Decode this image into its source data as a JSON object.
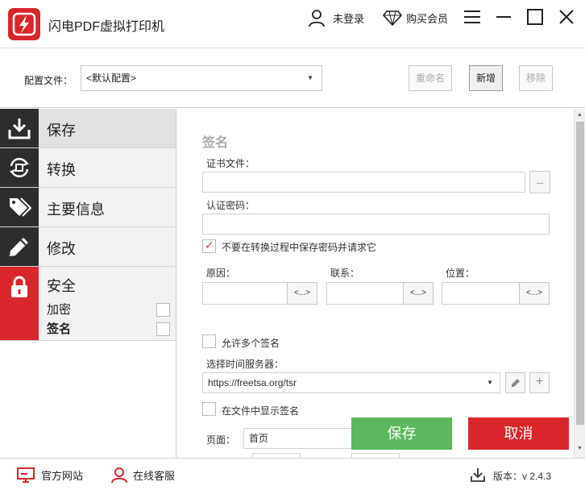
{
  "app": {
    "title": "闪电PDF虚拟打印机"
  },
  "header": {
    "login_label": "未登录",
    "vip_label": "购买会员"
  },
  "config": {
    "label": "配置文件：",
    "selected": "<默认配置>",
    "rename_label": "重命名",
    "new_label": "新增",
    "remove_label": "移除"
  },
  "sidebar": {
    "items": [
      {
        "label": "保存",
        "icon": "download-icon"
      },
      {
        "label": "转换",
        "icon": "convert-icon"
      },
      {
        "label": "主要信息",
        "icon": "tag-icon"
      },
      {
        "label": "修改",
        "icon": "pencil-icon"
      }
    ],
    "security": {
      "label": "安全",
      "icon": "lock-icon",
      "sub_items": [
        {
          "label": "加密",
          "checked": false
        },
        {
          "label": "签名",
          "checked": false
        }
      ]
    }
  },
  "signature": {
    "title": "签名",
    "cert_file_label": "证书文件：",
    "cert_file_value": "",
    "browse_label": "...",
    "password_label": "认证密码：",
    "password_value": "",
    "no_save_password_label": "不要在转换过程中保存密码并请求它",
    "no_save_password_checked": true,
    "reason_label": "原因：",
    "contact_label": "联系：",
    "location_label": "位置：",
    "insert_label": "<...>",
    "allow_multiple_label": "允许多个签名",
    "allow_multiple_checked": false,
    "time_server_label": "选择时间服务器：",
    "time_server_value": "https://freetsa.org/tsr",
    "show_signature_label": "在文件中显示签名",
    "show_signature_checked": false,
    "page_label": "页面：",
    "page_value": "首页"
  },
  "actions": {
    "save_label": "保存",
    "cancel_label": "取消"
  },
  "footer": {
    "website_label": "官方网站",
    "service_label": "在线客服",
    "version_label": "版本：v 2.4.3"
  },
  "colors": {
    "brand_red": "#d9262b",
    "save_green": "#5cb85c",
    "nav_dark": "#2d2d2d"
  }
}
